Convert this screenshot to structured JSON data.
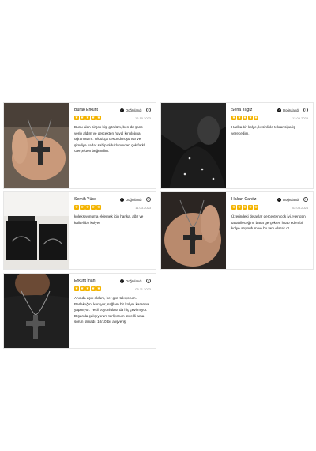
{
  "colors": {
    "star": "#f4b400",
    "border": "#e6e6e6"
  },
  "reviews": [
    {
      "name": "Burak Erkunt",
      "verified": "Doğrulandı",
      "date": "16.10.2023",
      "stars": "★★★★★",
      "text": "Bunu alan birçok kişi gördüm, ben de şans verip aldım ve gerçekten hayal kırıklığına uğramadım. Oldukça cesur duruşu var ve şimdiye kadar sahip olduklarımdan çok farklı. Gerçekten beğendim."
    },
    {
      "name": "Sena Yağız",
      "verified": "Doğrulandı",
      "date": "12.09.2023",
      "stars": "★★★★★",
      "text": "Harika bir kolye, kesinlikle tekrar sipariş vereceğim."
    },
    {
      "name": "Semih Yüce",
      "verified": "Doğrulandı",
      "date": "11.03.2023",
      "stars": "★★★★★",
      "text": "koleksiyonuma eklemek için harika, ağır ve kaliteli bir kolye!"
    },
    {
      "name": "Hakan Canöz",
      "verified": "Doğrulandı",
      "date": "02.08.2024",
      "stars": "★★★★★",
      "text": "Üzerindeki detaylar gerçekten çok iyi. Her gün takabileceğim, bana gerçekten hitap eden bir kolye arıyordum ve bu tam olarak o!"
    },
    {
      "name": "Erkunt İnan",
      "verified": "Doğrulandı",
      "date": "05.11.2023",
      "stars": "★★★★★",
      "text": "Anında aşık oldum, her gün takıyorum. Parlaklığını koruyor, sağlam bir kolye, kararma yapmıyor. Yeşil boyunlulara da hiç çevirmiyor. Dışarıda çalışıyorum terliyorum sürekli ama sorun olmadı. 10/10 bir alışveriş"
    }
  ]
}
